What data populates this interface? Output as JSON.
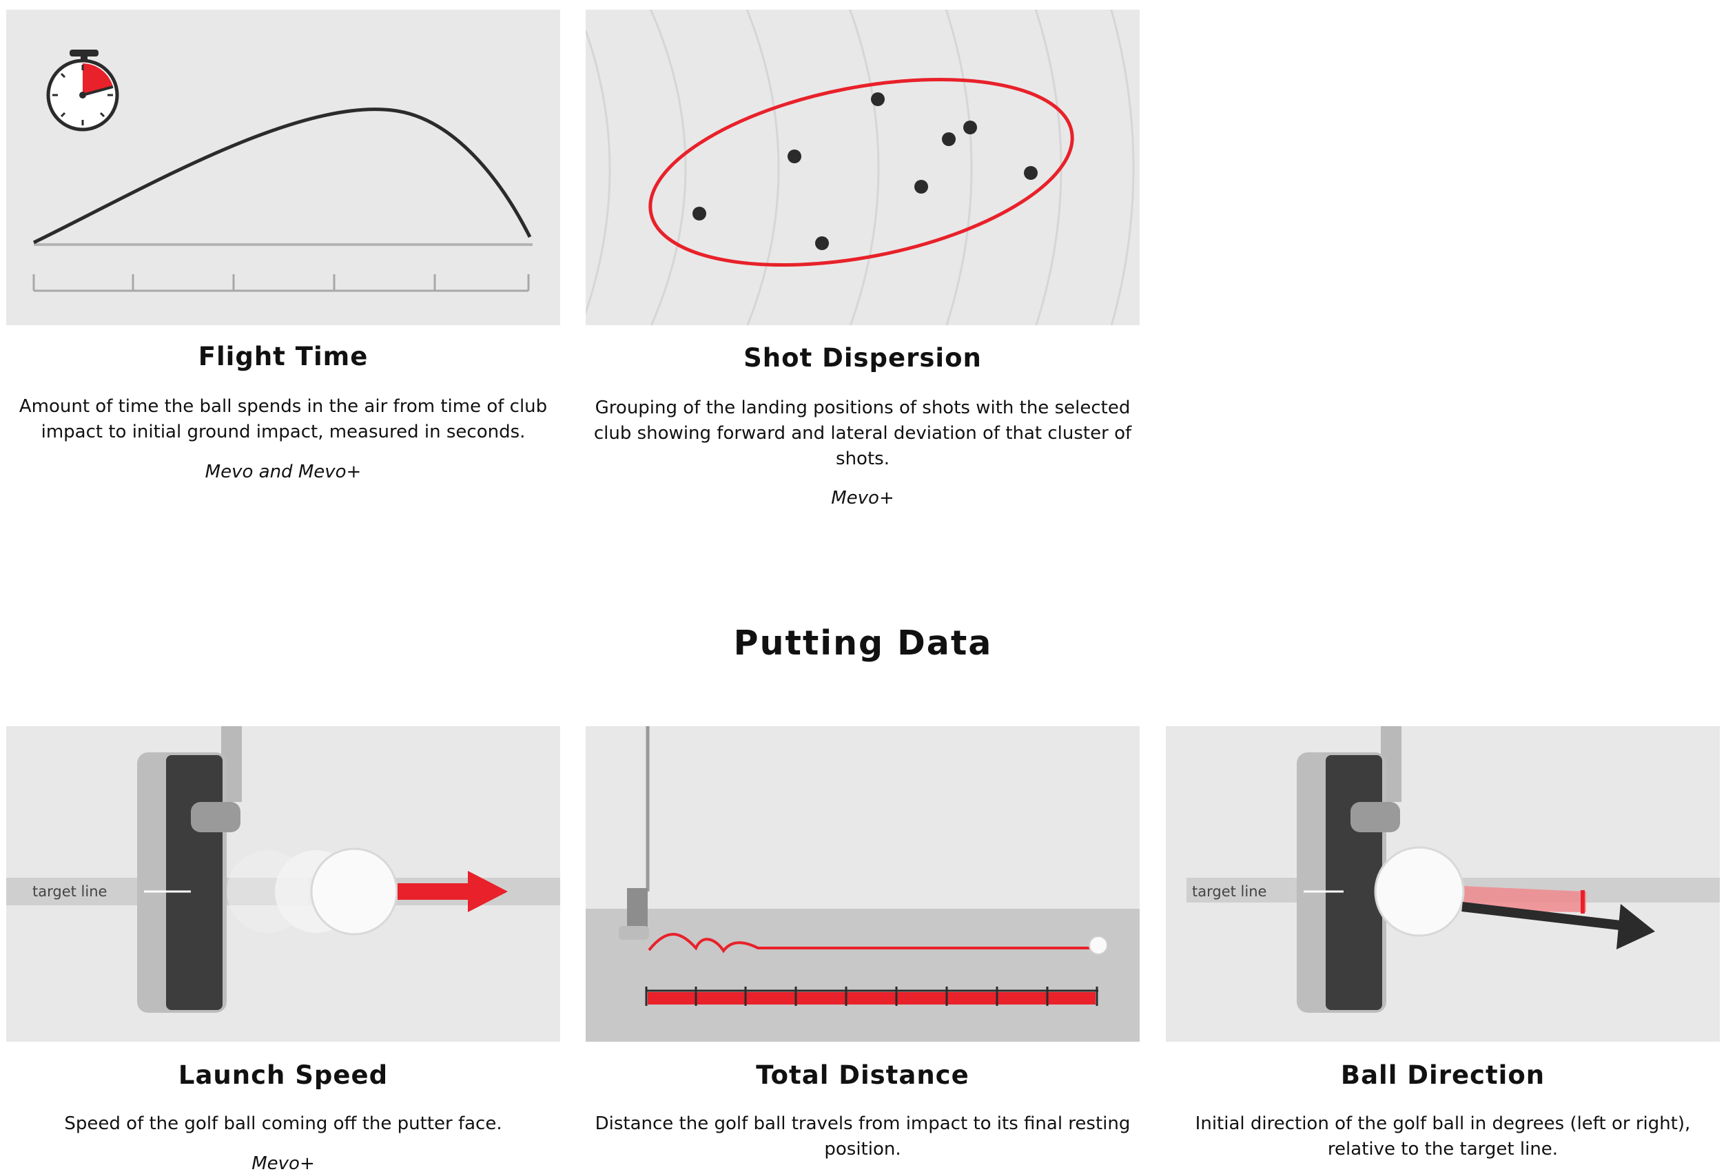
{
  "cards_top": [
    {
      "title": "Flight Time",
      "description": "Amount of time the ball spends in the air from time of club impact to initial ground impact, measured in seconds.",
      "availability": "Mevo and Mevo+",
      "icon": "stopwatch-icon"
    },
    {
      "title": "Shot Dispersion",
      "description": "Grouping of the landing positions of shots with the selected club showing forward and lateral deviation of that cluster of shots.",
      "availability": "Mevo+"
    }
  ],
  "putting": {
    "section_title": "Putting Data",
    "cards": [
      {
        "title": "Launch Speed",
        "description": "Speed of the golf ball coming off the putter face.",
        "availability": "Mevo+",
        "illustration_label": "target line"
      },
      {
        "title": "Total Distance",
        "description": "Distance the golf ball travels from impact to its final resting position."
      },
      {
        "title": "Ball Direction",
        "description": "Initial direction of the golf ball in degrees (left or right), relative to the target line.",
        "illustration_label": "target line"
      }
    ]
  },
  "colors": {
    "accent_red": "#e8212a",
    "panel_bg": "#e8e8e8",
    "dark": "#2b2b2b"
  }
}
